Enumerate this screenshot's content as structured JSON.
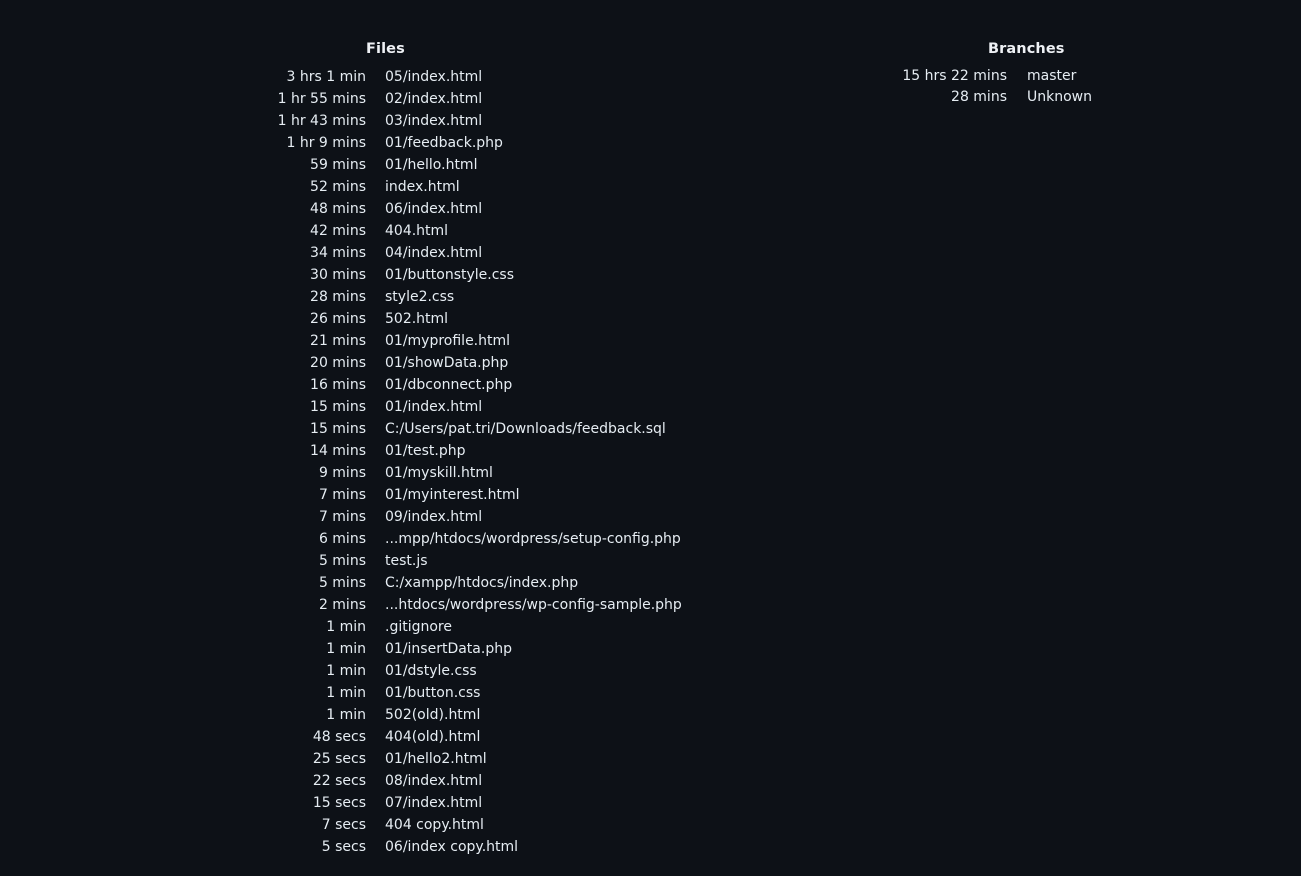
{
  "files": {
    "heading": "Files",
    "rows": [
      {
        "time": "3 hrs 1 min",
        "name": "05/index.html"
      },
      {
        "time": "1 hr 55 mins",
        "name": "02/index.html"
      },
      {
        "time": "1 hr 43 mins",
        "name": "03/index.html"
      },
      {
        "time": "1 hr 9 mins",
        "name": "01/feedback.php"
      },
      {
        "time": "59 mins",
        "name": "01/hello.html"
      },
      {
        "time": "52 mins",
        "name": "index.html"
      },
      {
        "time": "48 mins",
        "name": "06/index.html"
      },
      {
        "time": "42 mins",
        "name": "404.html"
      },
      {
        "time": "34 mins",
        "name": "04/index.html"
      },
      {
        "time": "30 mins",
        "name": "01/buttonstyle.css"
      },
      {
        "time": "28 mins",
        "name": "style2.css"
      },
      {
        "time": "26 mins",
        "name": "502.html"
      },
      {
        "time": "21 mins",
        "name": "01/myprofile.html"
      },
      {
        "time": "20 mins",
        "name": "01/showData.php"
      },
      {
        "time": "16 mins",
        "name": "01/dbconnect.php"
      },
      {
        "time": "15 mins",
        "name": "01/index.html"
      },
      {
        "time": "15 mins",
        "name": "C:/Users/pat.tri/Downloads/feedback.sql"
      },
      {
        "time": "14 mins",
        "name": "01/test.php"
      },
      {
        "time": "9 mins",
        "name": "01/myskill.html"
      },
      {
        "time": "7 mins",
        "name": "01/myinterest.html"
      },
      {
        "time": "7 mins",
        "name": "09/index.html"
      },
      {
        "time": "6 mins",
        "name": "...mpp/htdocs/wordpress/setup-config.php"
      },
      {
        "time": "5 mins",
        "name": "test.js"
      },
      {
        "time": "5 mins",
        "name": "C:/xampp/htdocs/index.php"
      },
      {
        "time": "2 mins",
        "name": "...htdocs/wordpress/wp-config-sample.php"
      },
      {
        "time": "1 min",
        "name": ".gitignore"
      },
      {
        "time": "1 min",
        "name": "01/insertData.php"
      },
      {
        "time": "1 min",
        "name": "01/dstyle.css"
      },
      {
        "time": "1 min",
        "name": "01/button.css"
      },
      {
        "time": "1 min",
        "name": "502(old).html"
      },
      {
        "time": "48 secs",
        "name": "404(old).html"
      },
      {
        "time": "25 secs",
        "name": "01/hello2.html"
      },
      {
        "time": "22 secs",
        "name": "08/index.html"
      },
      {
        "time": "15 secs",
        "name": "07/index.html"
      },
      {
        "time": "7 secs",
        "name": "404 copy.html"
      },
      {
        "time": "5 secs",
        "name": "06/index copy.html"
      }
    ]
  },
  "branches": {
    "heading": "Branches",
    "rows": [
      {
        "time": "15 hrs 22 mins",
        "name": "master"
      },
      {
        "time": "28 mins",
        "name": "Unknown"
      }
    ]
  },
  "colors": {
    "background": "#0d1117",
    "text": "#e6edf3"
  }
}
